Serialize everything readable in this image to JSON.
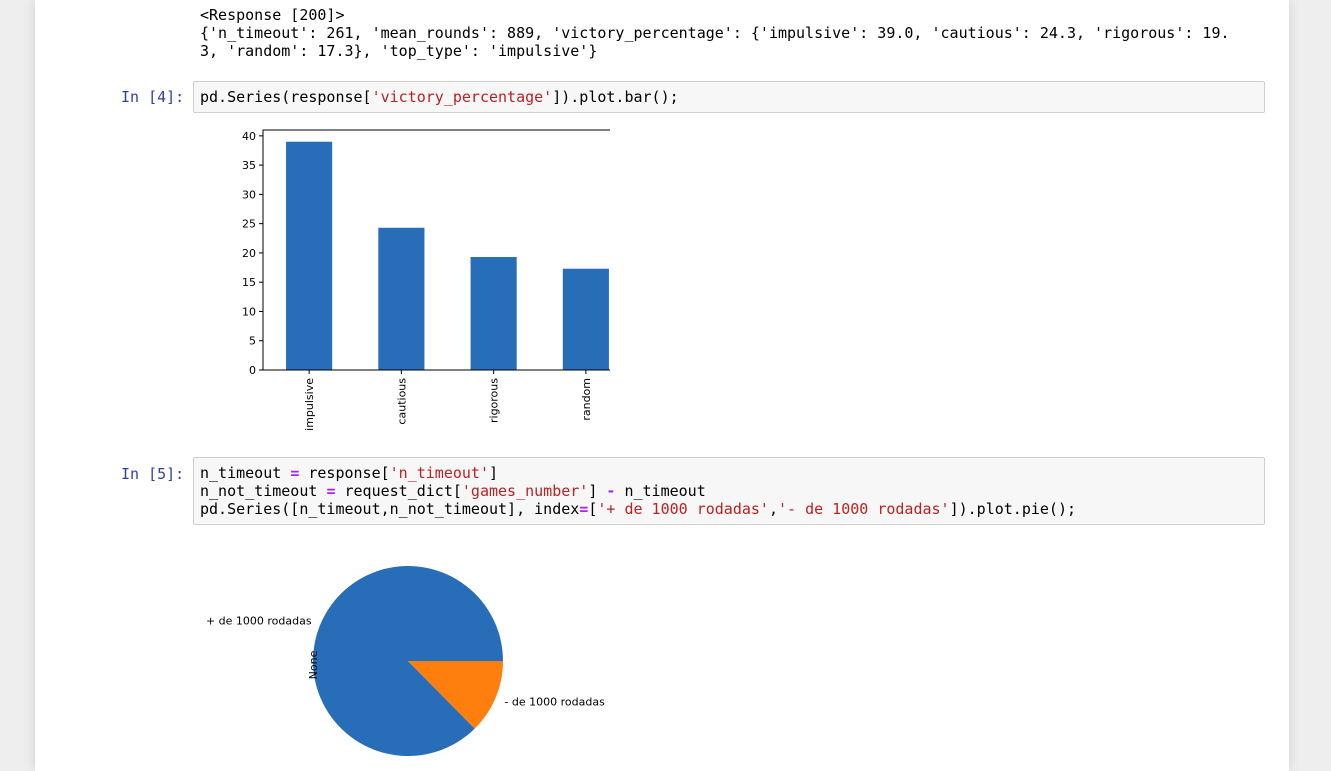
{
  "output_top": {
    "line1": "<Response [200]>",
    "line2": "{'n_timeout': 261, 'mean_rounds': 889, 'victory_percentage': {'impulsive': 39.0, 'cautious': 24.3, 'rigorous': 19.",
    "line3": "3, 'random': 17.3}, 'top_type': 'impulsive'}"
  },
  "cell4": {
    "prompt": "In [4]:",
    "code": {
      "a": "pd.Series(response[",
      "s1": "'victory_percentage'",
      "b": "]).plot.bar();"
    }
  },
  "cell5": {
    "prompt": "In [5]:",
    "line1": {
      "a": "n_timeout ",
      "op": "=",
      "b": " response[",
      "s": "'n_timeout'",
      "c": "]"
    },
    "line2": {
      "a": "n_not_timeout ",
      "op": "=",
      "b": " request_dict[",
      "s": "'games_number'",
      "c": "] ",
      "op2": "-",
      "d": " n_timeout"
    },
    "line3": {
      "a": "pd.Series([n_timeout,n_not_timeout], index",
      "op": "=",
      "b": "[",
      "s1": "'+ de 1000 rodadas'",
      "c": ",",
      "s2": "'- de 1000 rodadas'",
      "d": "]).plot.pie();"
    }
  },
  "chart_data": [
    {
      "type": "bar",
      "categories": [
        "impulsive",
        "cautious",
        "rigorous",
        "random"
      ],
      "values": [
        39.0,
        24.3,
        19.3,
        17.3
      ],
      "ylim": [
        0,
        41
      ],
      "yticks": [
        0,
        5,
        10,
        15,
        20,
        25,
        30,
        35,
        40
      ],
      "color": "#286db8",
      "grid": false
    },
    {
      "type": "pie",
      "labels": [
        "+ de 1000 rodadas",
        "- de 1000 rodadas"
      ],
      "ylabel": "None",
      "colors": [
        "#286db8",
        "#ff7f0e"
      ],
      "values": [
        0.874,
        0.126
      ]
    }
  ]
}
